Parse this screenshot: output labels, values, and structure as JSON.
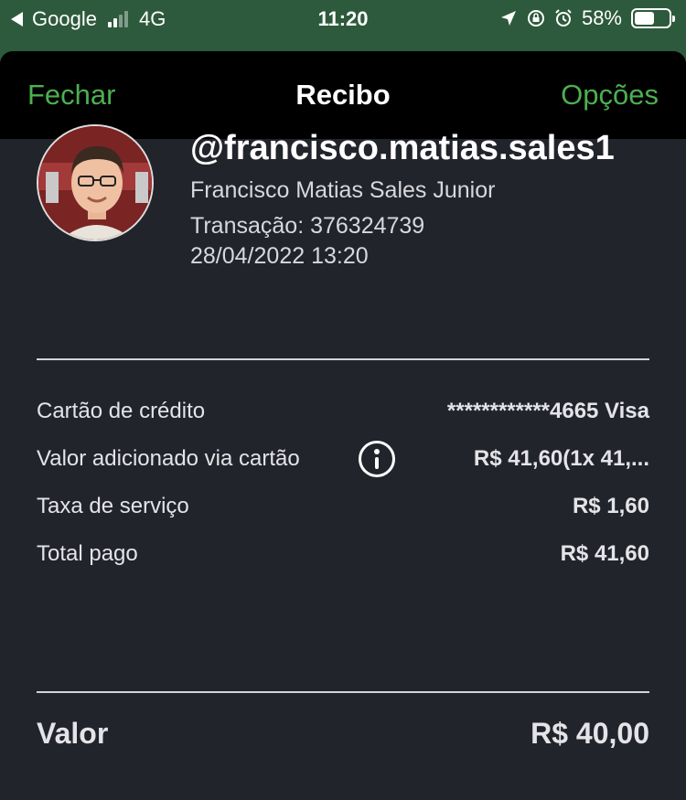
{
  "status_bar": {
    "back_app": "Google",
    "network": "4G",
    "time": "11:20",
    "battery": "58%",
    "battery_level": 0.58,
    "icons": [
      "location-arrow-icon",
      "orientation-lock-icon",
      "alarm-icon"
    ]
  },
  "nav": {
    "close_label": "Fechar",
    "title": "Recibo",
    "options_label": "Opções",
    "accent_color": "#4caf50"
  },
  "profile": {
    "username": "@francisco.matias.sales1",
    "full_name": "Francisco Matias Sales Junior",
    "transaction": "Transação: 376324739",
    "datetime": "28/04/2022 13:20"
  },
  "details": [
    {
      "label": "Cartão de crédito",
      "value": "************4665 Visa"
    },
    {
      "label": "Valor adicionado via cartão",
      "value": "R$ 41,60(1x 41,..."
    },
    {
      "label": "Taxa de serviço",
      "value": "R$ 1,60"
    },
    {
      "label": "Total pago",
      "value": "R$ 41,60"
    }
  ],
  "total": {
    "label": "Valor",
    "value": "R$ 40,00"
  }
}
